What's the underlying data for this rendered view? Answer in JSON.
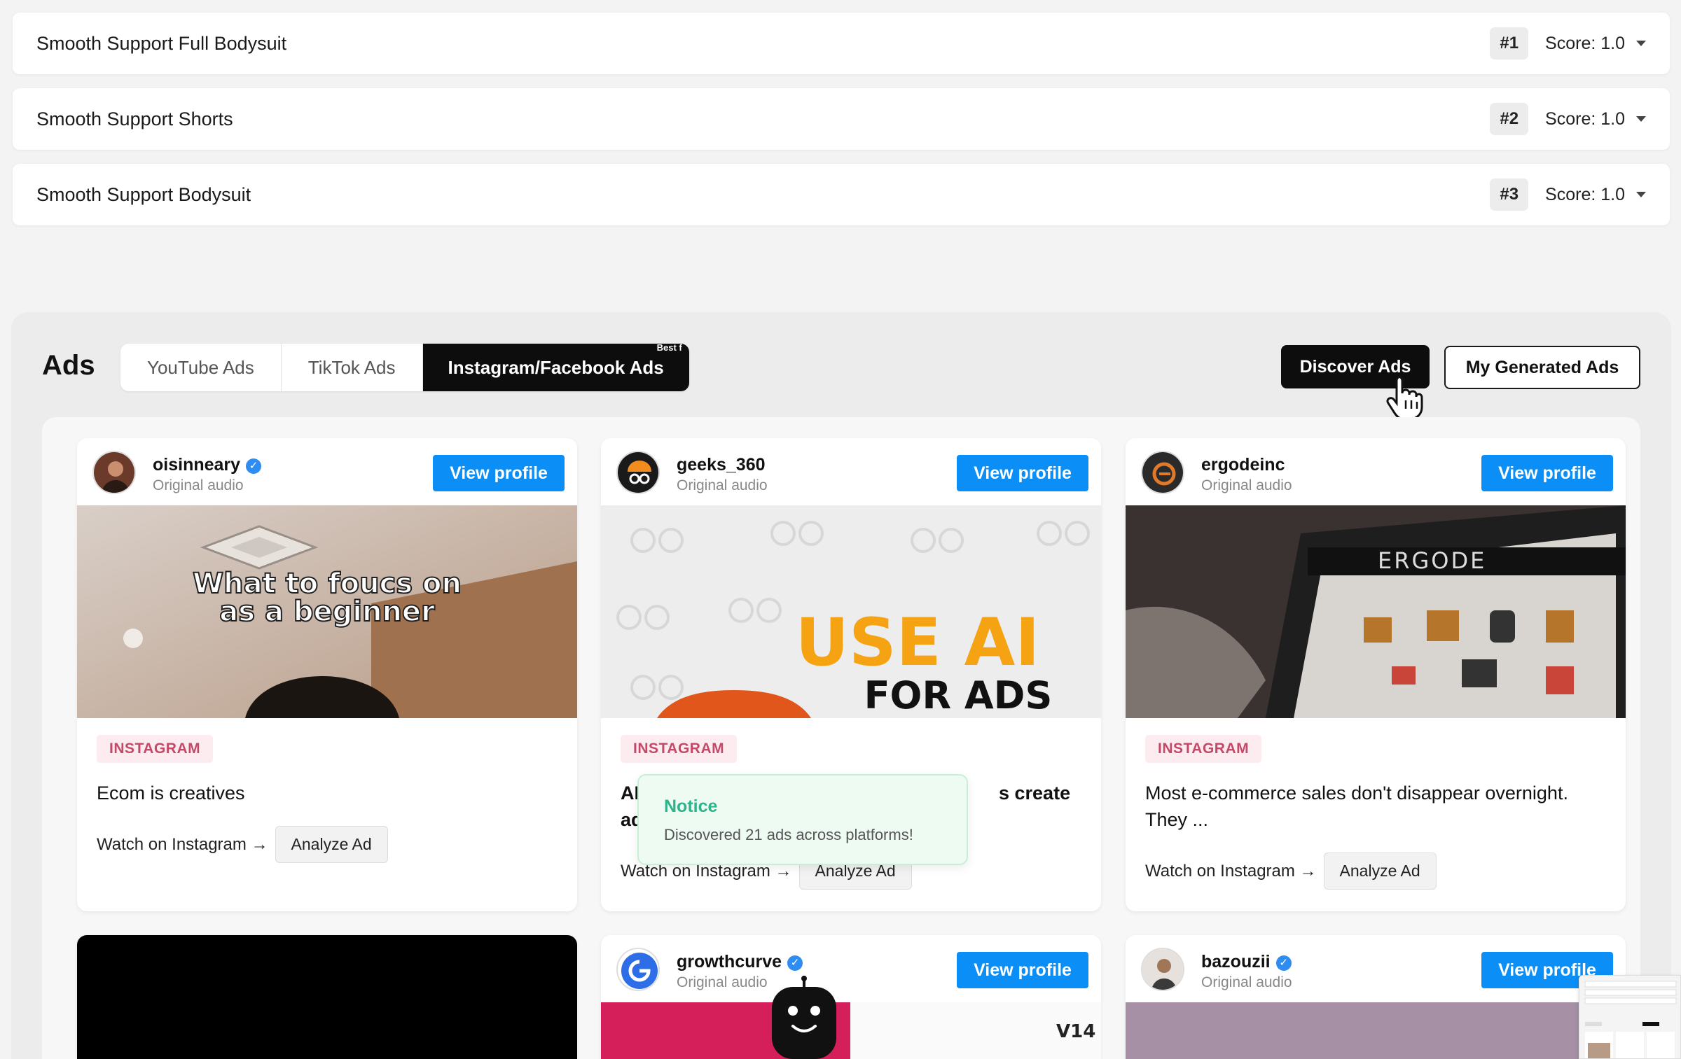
{
  "products": [
    {
      "name": "Smooth Support Full Bodysuit",
      "rank": "#1",
      "score": "Score: 1.0"
    },
    {
      "name": "Smooth Support Shorts",
      "rank": "#2",
      "score": "Score: 1.0"
    },
    {
      "name": "Smooth Support Bodysuit",
      "rank": "#3",
      "score": "Score: 1.0"
    }
  ],
  "ads": {
    "title": "Ads",
    "tabs": [
      "YouTube Ads",
      "TikTok Ads",
      "Instagram/Facebook Ads"
    ],
    "active_tab_tag": "Best f",
    "discover_label": "Discover Ads",
    "generated_label": "My Generated Ads"
  },
  "cards": [
    {
      "account": "oisinneary",
      "audio": "Original audio",
      "view_label": "View profile",
      "thumb_text_1": "What to foucs on",
      "thumb_text_2": "as a beginner",
      "platform": "INSTAGRAM",
      "caption": "Ecom is creatives",
      "watch": "Watch on Instagram →",
      "analyze": "Analyze Ad"
    },
    {
      "account": "geeks_360",
      "audio": "Original audio",
      "view_label": "View profile",
      "thumb_text_1": "USE AI",
      "thumb_text_2": "FOR ADS",
      "platform": "INSTAGRAM",
      "caption_left": "AI i",
      "caption_left_2": "ads",
      "caption_right": "s create",
      "watch": "Watch on Instagram →",
      "analyze": "Analyze Ad"
    },
    {
      "account": "ergodeinc",
      "audio": "Original audio",
      "view_label": "View profile",
      "thumb_text_1": "ERGODE",
      "platform": "INSTAGRAM",
      "caption": "Most e-commerce sales don't disappear overnight. They ...",
      "watch": "Watch on Instagram →",
      "analyze": "Analyze Ad"
    },
    {
      "account": "growthcurve",
      "audio": "Original audio",
      "view_label": "View profile",
      "thumb_text_1": "V14"
    },
    {
      "account": "bazouzii",
      "audio": "Original audio",
      "view_label": "View profile"
    }
  ],
  "notice": {
    "title": "Notice",
    "message": "Discovered 21 ads across platforms!"
  },
  "colors": {
    "accent_blue": "#0b8ef5",
    "instagram_badge": "#c24a68",
    "notice_green": "#2db48a",
    "dark_button": "#0d0d0d"
  }
}
